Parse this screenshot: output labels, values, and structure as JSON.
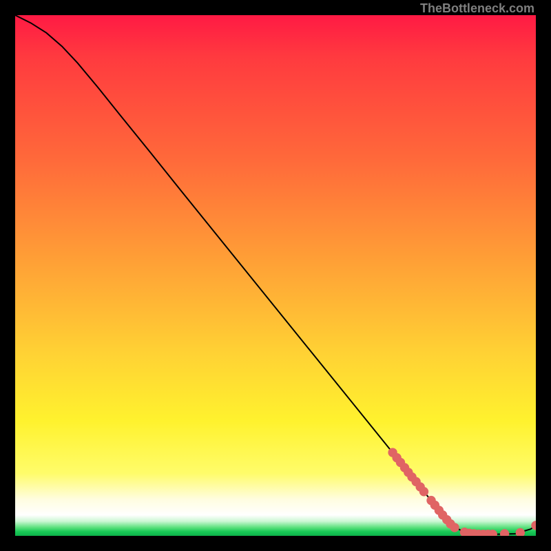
{
  "attribution": "TheBottleneck.com",
  "colors": {
    "marker": "#e06464",
    "curve": "#000000",
    "frame": "#000000"
  },
  "chart_data": {
    "type": "line",
    "title": "",
    "xlabel": "",
    "ylabel": "",
    "xlim": [
      0,
      100
    ],
    "ylim": [
      0,
      100
    ],
    "grid": false,
    "legend": false,
    "curve": [
      {
        "x": 0,
        "y": 100
      },
      {
        "x": 3,
        "y": 98.5
      },
      {
        "x": 6,
        "y": 96.6
      },
      {
        "x": 9,
        "y": 94.0
      },
      {
        "x": 12,
        "y": 90.8
      },
      {
        "x": 16,
        "y": 86.0
      },
      {
        "x": 20,
        "y": 81.0
      },
      {
        "x": 26,
        "y": 73.6
      },
      {
        "x": 32,
        "y": 66.1
      },
      {
        "x": 40,
        "y": 56.2
      },
      {
        "x": 48,
        "y": 46.3
      },
      {
        "x": 56,
        "y": 36.4
      },
      {
        "x": 64,
        "y": 26.5
      },
      {
        "x": 72,
        "y": 16.6
      },
      {
        "x": 76.5,
        "y": 11.0
      },
      {
        "x": 81.0,
        "y": 5.4
      },
      {
        "x": 84.0,
        "y": 2.0
      },
      {
        "x": 86.0,
        "y": 0.8
      },
      {
        "x": 88.0,
        "y": 0.4
      },
      {
        "x": 92.0,
        "y": 0.3
      },
      {
        "x": 96.0,
        "y": 0.4
      },
      {
        "x": 99.0,
        "y": 1.3
      },
      {
        "x": 100.0,
        "y": 2.0
      }
    ],
    "markers": [
      {
        "x": 72.5,
        "y": 16.0
      },
      {
        "x": 73.3,
        "y": 15.0
      },
      {
        "x": 74.0,
        "y": 14.1
      },
      {
        "x": 74.8,
        "y": 13.1
      },
      {
        "x": 75.5,
        "y": 12.2
      },
      {
        "x": 76.2,
        "y": 11.3
      },
      {
        "x": 77.0,
        "y": 10.4
      },
      {
        "x": 77.8,
        "y": 9.4
      },
      {
        "x": 78.5,
        "y": 8.5
      },
      {
        "x": 79.9,
        "y": 6.8
      },
      {
        "x": 80.6,
        "y": 5.9
      },
      {
        "x": 81.4,
        "y": 4.9
      },
      {
        "x": 82.1,
        "y": 4.0
      },
      {
        "x": 82.9,
        "y": 3.1
      },
      {
        "x": 83.6,
        "y": 2.3
      },
      {
        "x": 84.4,
        "y": 1.6
      },
      {
        "x": 86.3,
        "y": 0.7
      },
      {
        "x": 87.2,
        "y": 0.5
      },
      {
        "x": 88.1,
        "y": 0.4
      },
      {
        "x": 89.0,
        "y": 0.3
      },
      {
        "x": 89.9,
        "y": 0.3
      },
      {
        "x": 90.8,
        "y": 0.3
      },
      {
        "x": 91.7,
        "y": 0.3
      },
      {
        "x": 94.0,
        "y": 0.4
      },
      {
        "x": 97.0,
        "y": 0.6
      },
      {
        "x": 100.0,
        "y": 2.0
      }
    ]
  }
}
